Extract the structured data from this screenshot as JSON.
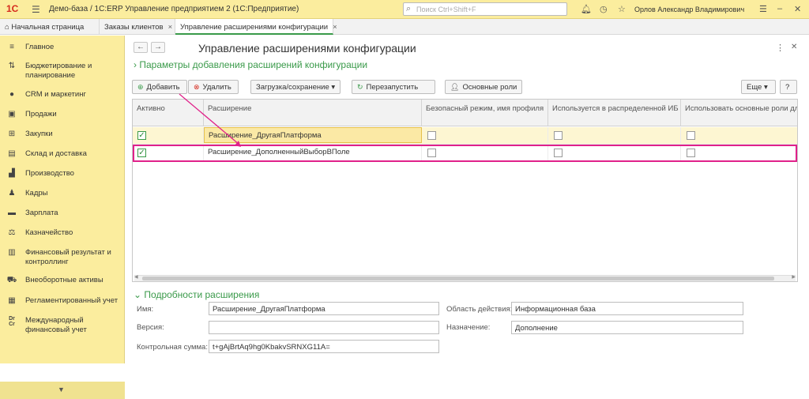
{
  "titlebar": {
    "logo": "1С",
    "menu_icon": "hamburger-icon",
    "title": "Демо-база / 1С:ERP Управление предприятием 2  (1С:Предприятие)",
    "search_placeholder": "Поиск Ctrl+Shift+F",
    "user": "Орлов Александр Владимирович"
  },
  "tabs": [
    {
      "label": "Начальная страница"
    },
    {
      "label": "Заказы клиентов"
    },
    {
      "label": "Управление расширениями конфигурации"
    }
  ],
  "sidebar": {
    "items": [
      {
        "label": "Главное",
        "icon": "menu-icon"
      },
      {
        "label": "Бюджетирование и планирование",
        "icon": "chart-icon"
      },
      {
        "label": "CRM и маркетинг",
        "icon": "crm-icon"
      },
      {
        "label": "Продажи",
        "icon": "sales-icon"
      },
      {
        "label": "Закупки",
        "icon": "cart-icon"
      },
      {
        "label": "Склад и доставка",
        "icon": "truck-icon"
      },
      {
        "label": "Производство",
        "icon": "factory-icon"
      },
      {
        "label": "Кадры",
        "icon": "person-icon"
      },
      {
        "label": "Зарплата",
        "icon": "salary-icon"
      },
      {
        "label": "Казначейство",
        "icon": "treasury-icon"
      },
      {
        "label": "Финансовый результат и контроллинг",
        "icon": "finance-icon"
      },
      {
        "label": "Внеоборотные активы",
        "icon": "assets-icon"
      },
      {
        "label": "Регламентированный учет",
        "icon": "ledger-icon"
      },
      {
        "label": "Международный финансовый учет",
        "icon": "intl-finance-icon"
      }
    ]
  },
  "page": {
    "title": "Управление расширениями конфигурации",
    "section": "Параметры добавления расширений конфигурации"
  },
  "toolbar": {
    "add": "Добавить",
    "delete": "Удалить",
    "load_save": "Загрузка/сохранение",
    "restart": "Перезапустить",
    "roles": "Основные роли",
    "more": "Еще",
    "help": "?"
  },
  "table": {
    "columns": [
      "Активно",
      "Расширение",
      "Безопасный режим, имя профиля",
      "Используется в распределенной ИБ",
      "Использовать основные роли для"
    ],
    "rows": [
      {
        "active": true,
        "name": "Расширение_ДругаяПлатформа",
        "safe": false,
        "distributed": false,
        "roles": false
      },
      {
        "active": true,
        "name": "Расширение_ДополненныйВыборВПоле",
        "safe": false,
        "distributed": false,
        "roles": false
      }
    ]
  },
  "details": {
    "title": "Подробности расширения",
    "name_label": "Имя:",
    "name_value": "Расширение_ДругаяПлатформа",
    "version_label": "Версия:",
    "version_value": "",
    "checksum_label": "Контрольная сумма:",
    "checksum_value": "t+gAjBrtAq9hg0KbakvSRNXG11A=",
    "scope_label": "Область действия:",
    "scope_value": "Информационная база",
    "purpose_label": "Назначение:",
    "purpose_value": "Дополнение"
  },
  "colors": {
    "accent": "#3a9a4a",
    "sidebar": "#fbed9e",
    "highlight": "#e0218a"
  }
}
